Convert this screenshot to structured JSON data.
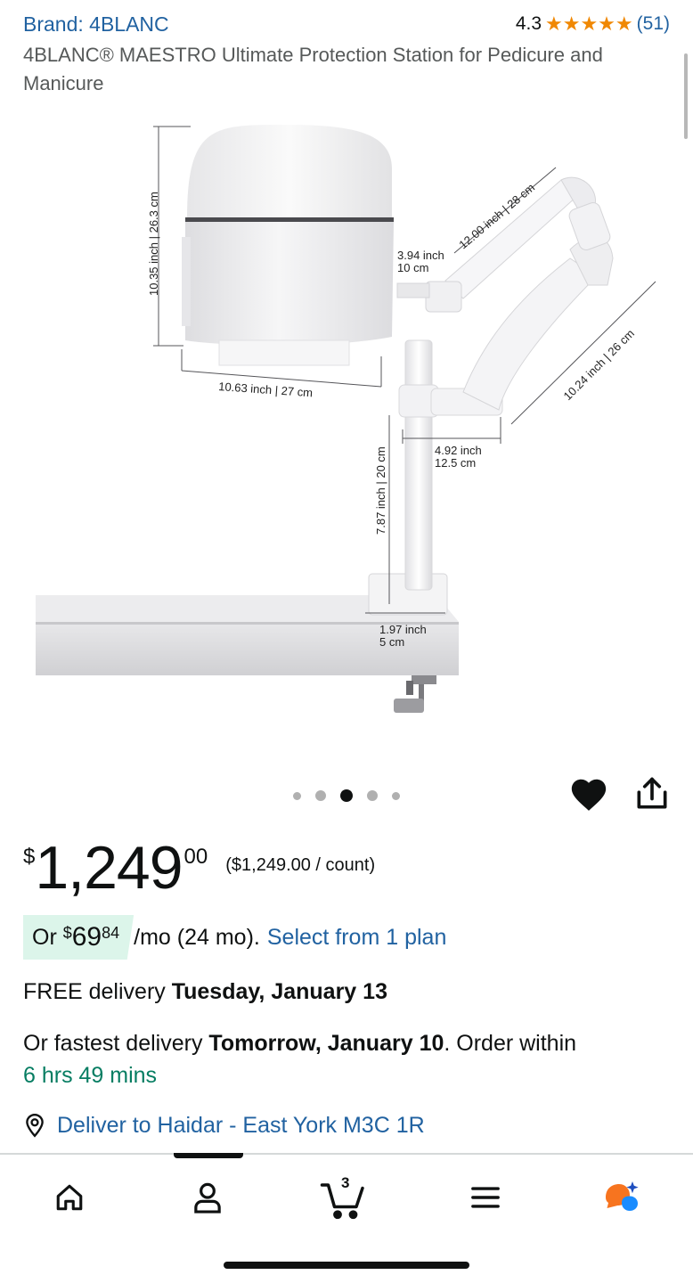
{
  "product": {
    "brand": "Brand: 4BLANC",
    "rating_value": "4.3",
    "rating_stars": "★★★★★",
    "rating_count": "(51)",
    "title": "4BLANC® MAESTRO Ultimate Protection Station for Pedicure and Manicure"
  },
  "image": {
    "dimensions": {
      "height": "10.35 inch | 26.3 cm",
      "width": "10.63 inch | 27 cm",
      "hood_offset_in": "3.94 inch",
      "hood_offset_cm": "10 cm",
      "upper_arm": "12.00 inch | 28 cm",
      "lower_arm": "10.24 inch | 26 cm",
      "joint_in": "4.92 inch",
      "joint_cm": "12.5 cm",
      "pole": "7.87 inch | 20 cm",
      "clamp_in": "1.97 inch",
      "clamp_cm": "5 cm"
    },
    "carousel_dots": 5,
    "carousel_active_index": 2
  },
  "price": {
    "currency": "$",
    "whole": "1,249",
    "fraction": "00",
    "unit_price": "($1,249.00 / count)"
  },
  "installment": {
    "prefix": "Or",
    "currency": "$",
    "whole": "69",
    "fraction": "84",
    "term": "/mo (24 mo).",
    "link": "Select from 1 plan"
  },
  "delivery": {
    "free_prefix": "FREE delivery",
    "free_date": "Tuesday, January 13",
    "fastest_prefix": "Or fastest delivery",
    "fastest_date": "Tomorrow, January 10",
    "order_within": ". Order within",
    "countdown": "6 hrs 49 mins"
  },
  "deliver_to": {
    "text": "Deliver to Haidar - East York M3C 1R"
  },
  "nav": {
    "cart_count": "3",
    "items": [
      "home-icon",
      "account-icon",
      "cart-icon",
      "menu-icon",
      "rufus-ai-icon"
    ]
  },
  "colors": {
    "link": "#2162a1",
    "star": "#f08804",
    "green": "#067d62",
    "installment_bg": "#dcf5ea"
  }
}
